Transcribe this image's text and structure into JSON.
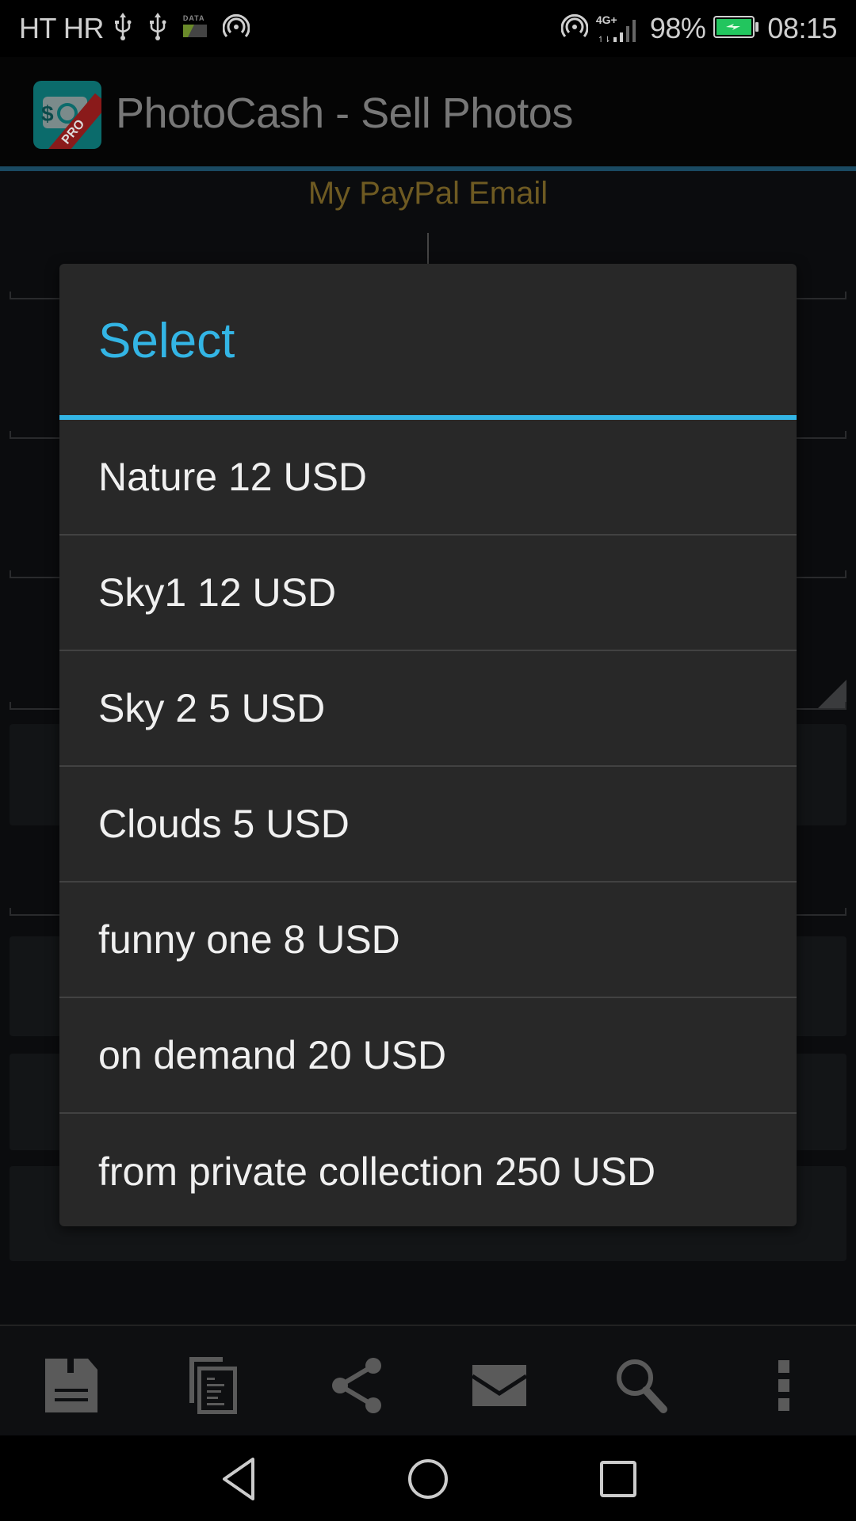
{
  "status_bar": {
    "carrier": "HT HR",
    "data_badge": "DATA",
    "network_type": "4G+",
    "battery_percent": "98%",
    "battery_level": 0.98,
    "battery_charging": true,
    "time": "08:15",
    "icons": [
      "usb-icon",
      "usb-icon",
      "data-icon",
      "hotspot-icon",
      "hotspot-icon",
      "signal-icon",
      "battery-icon"
    ]
  },
  "app": {
    "title": "PhotoCash - Sell Photos",
    "logo_badge": "PRO",
    "logo_symbol": "$",
    "paypal_label": "My PayPal Email",
    "accent_color": "#1a4a62",
    "label_color": "#6e5a22"
  },
  "dialog": {
    "title": "Select",
    "accent_color": "#33b5e5",
    "items": [
      {
        "label": "Nature 12 USD"
      },
      {
        "label": "Sky1 12 USD"
      },
      {
        "label": "Sky 2 5 USD"
      },
      {
        "label": "Clouds 5 USD"
      },
      {
        "label": "funny one 8 USD"
      },
      {
        "label": "on demand 20 USD"
      },
      {
        "label": "from private collection 250 USD"
      }
    ]
  },
  "bottom_bar": {
    "actions": [
      {
        "icon": "save-icon",
        "name": "save"
      },
      {
        "icon": "copy-icon",
        "name": "copy"
      },
      {
        "icon": "share-icon",
        "name": "share"
      },
      {
        "icon": "email-icon",
        "name": "email"
      },
      {
        "icon": "search-icon",
        "name": "search"
      },
      {
        "icon": "overflow-menu-icon",
        "name": "more"
      }
    ]
  },
  "nav_bar": {
    "buttons": [
      "back",
      "home",
      "recents"
    ]
  }
}
